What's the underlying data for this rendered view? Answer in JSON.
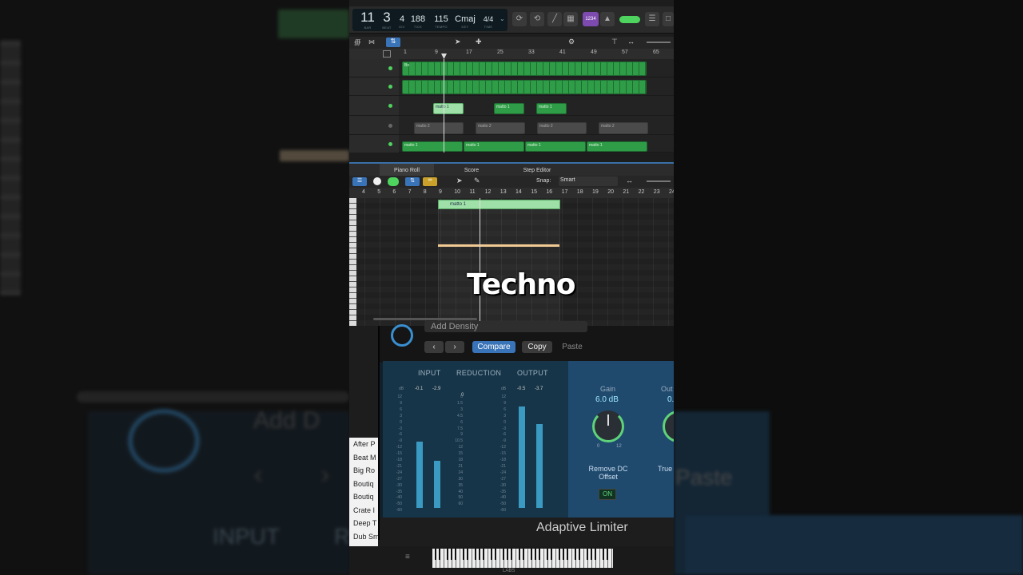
{
  "lcd": {
    "bar": "11",
    "beat": "3",
    "div": "4",
    "tick": "188",
    "tempo": "115",
    "key": "Cmaj",
    "time_sig": "4/4",
    "bar_cap": "BAR",
    "beat_cap": "BEAT",
    "div_cap": "DIV",
    "tick_cap": "TICK",
    "tempo_cap": "TEMPO",
    "key_cap": "KEY",
    "time_cap": "TIME",
    "count_in": "1234"
  },
  "tracks_ruler": [
    "1",
    "9",
    "17",
    "25",
    "33",
    "41",
    "49",
    "57",
    "65"
  ],
  "regions": {
    "lane1_label": "Bo",
    "lane3_label": "matto 1",
    "lane4_label": "matto 2",
    "lane5_label": "matto 1"
  },
  "editor": {
    "tabs": [
      "Piano Roll",
      "Score",
      "Step Editor"
    ],
    "snap_label": "Snap:",
    "snap_value": "Smart",
    "ruler": [
      "4",
      "5",
      "6",
      "7",
      "8",
      "9",
      "10",
      "11",
      "12",
      "13",
      "14",
      "15",
      "16",
      "17",
      "18",
      "19",
      "20",
      "21",
      "22",
      "23",
      "24"
    ],
    "region_name": "matto 1"
  },
  "caption": "Techno",
  "plugin": {
    "preset": "Add Density",
    "compare": "Compare",
    "copy": "Copy",
    "paste": "Paste",
    "input_label": "INPUT",
    "reduction_label": "REDUCTION",
    "output_label": "OUTPUT",
    "db": "dB",
    "input_vals": [
      "-0.1",
      "-2.9"
    ],
    "reduction_val": "0",
    "output_vals": [
      "-0.5",
      "-3.7"
    ],
    "scale_left": [
      "12",
      "9",
      "6",
      "3",
      "0",
      "-3",
      "-6",
      "-9",
      "-12",
      "-15",
      "-18",
      "-21",
      "-24",
      "-27",
      "-30",
      "-35",
      "-40",
      "-50",
      "-60"
    ],
    "scale_mid": [
      "0",
      "1.5",
      "3",
      "4.5",
      "6",
      "7.5",
      "9",
      "10.5",
      "12",
      "15",
      "18",
      "21",
      "24",
      "30",
      "35",
      "40",
      "50",
      "60"
    ],
    "input_levels": [
      0.62,
      0.44
    ],
    "output_levels": [
      0.95,
      0.78
    ],
    "gain_label": "Gain",
    "gain_value": "6.0 dB",
    "gain_min": "0",
    "gain_max": "12",
    "out_label": "Out",
    "out_value": "0.",
    "remove_dc": "Remove DC Offset",
    "dc_state": "ON",
    "true_peak": "True Det",
    "title": "Adaptive Limiter"
  },
  "browser": [
    "After P",
    "Beat M",
    "Big Ro",
    "Boutiq",
    "Boutiq",
    "Crate I",
    "Deep T",
    "Dub Smash SD"
  ],
  "keyboard_label": "LABS",
  "bg": {
    "left_small": "Add D",
    "input": "INPUT",
    "paste": "Paste",
    "r": "R"
  },
  "colors": {
    "accent_blue": "#3a74b8",
    "region_green": "#2f9d47",
    "meter_blue": "#3a9ac2",
    "panel_blue": "#1f4a6e"
  }
}
